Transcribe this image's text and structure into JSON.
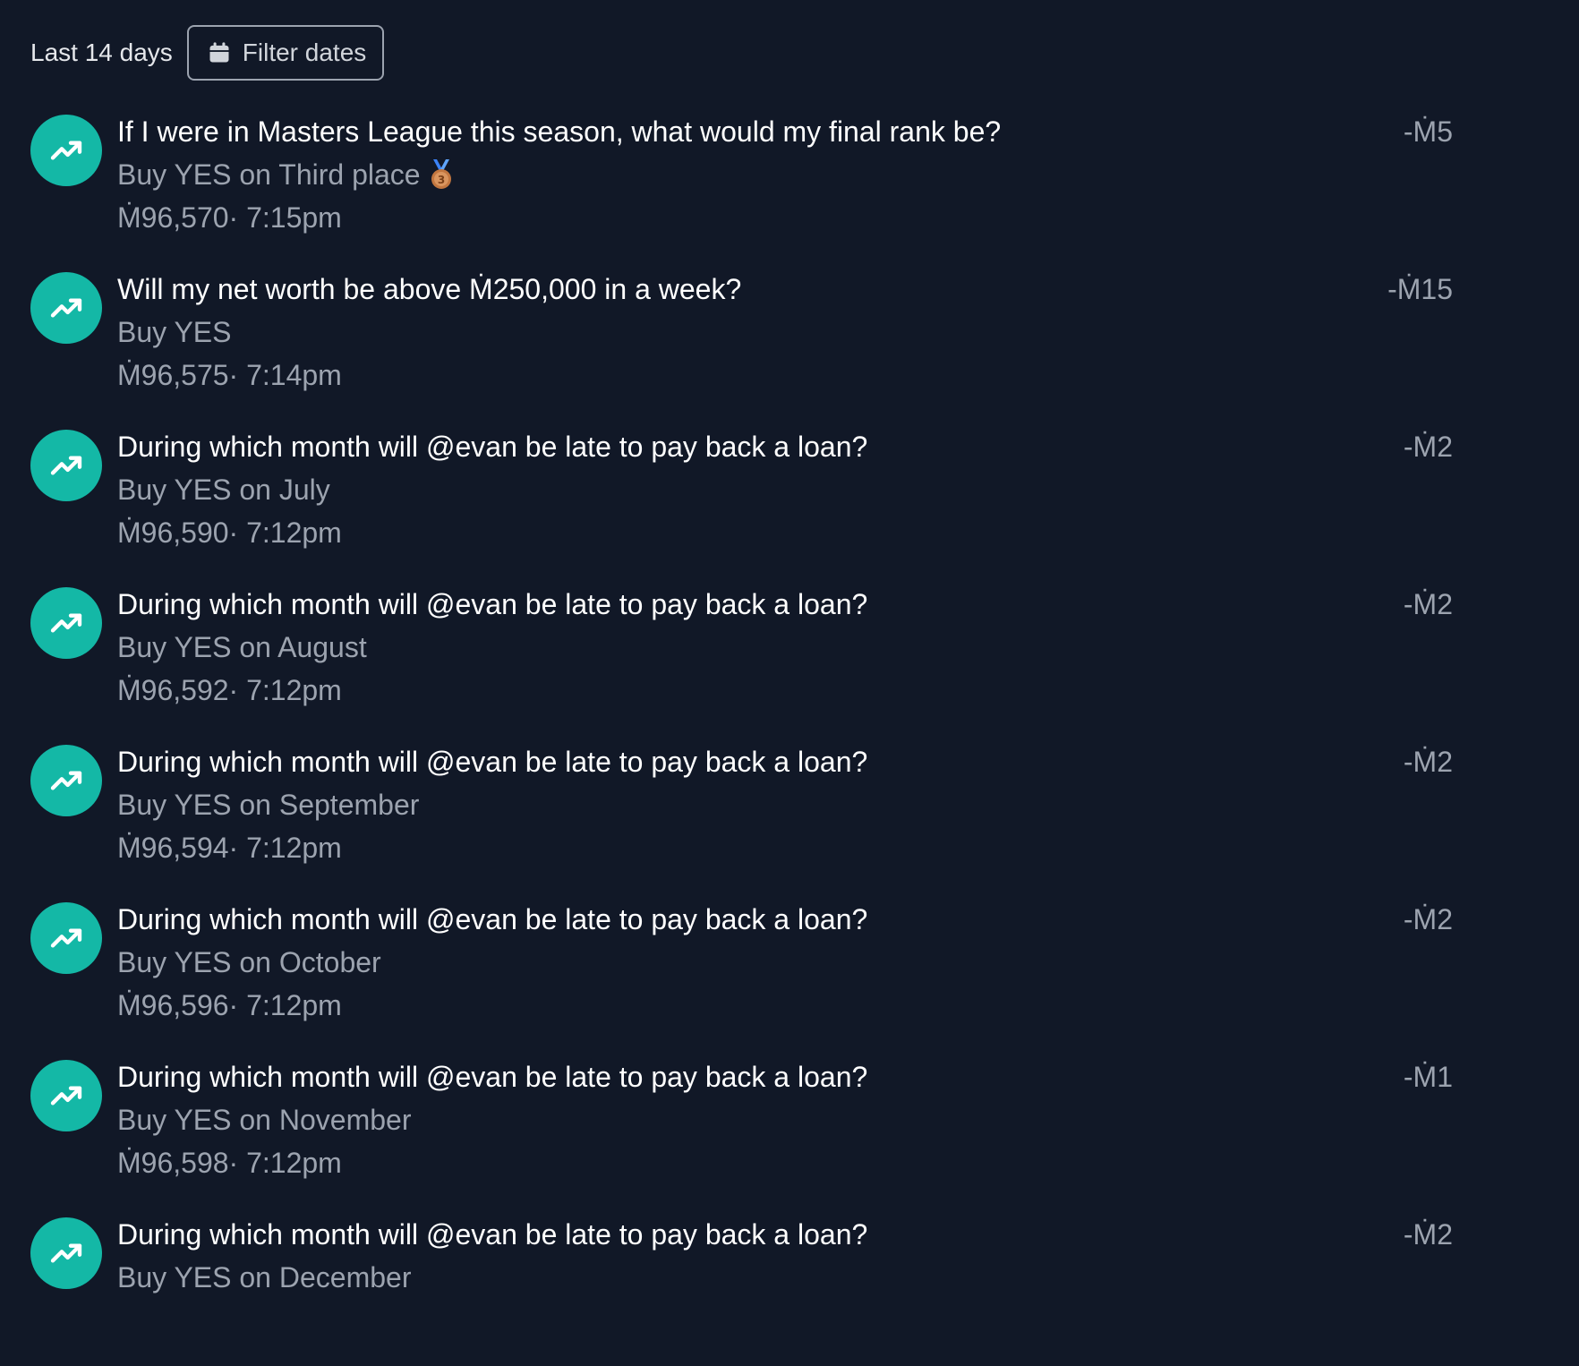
{
  "header": {
    "range_label": "Last 14 days",
    "filter_button_label": "Filter dates",
    "filter_icon": "calendar-icon"
  },
  "colors": {
    "background": "#111827",
    "accent": "#14b8a6",
    "text_primary": "#ffffff",
    "text_secondary": "#9ca3af"
  },
  "transactions": [
    {
      "icon": "trending-up-icon",
      "title": "If I were in Masters League this season, what would my final rank be?",
      "action": "Buy YES on Third place",
      "action_icon": "third-place-medal-icon",
      "meta": "Ṁ96,570· 7:15pm",
      "amount": "-Ṁ5"
    },
    {
      "icon": "trending-up-icon",
      "title": "Will my net worth be above Ṁ250,000 in a week?",
      "action": "Buy YES",
      "meta": "Ṁ96,575· 7:14pm",
      "amount": "-Ṁ15"
    },
    {
      "icon": "trending-up-icon",
      "title": "During which month will @evan be late to pay back a loan?",
      "action": "Buy YES on July",
      "meta": "Ṁ96,590· 7:12pm",
      "amount": "-Ṁ2"
    },
    {
      "icon": "trending-up-icon",
      "title": "During which month will @evan be late to pay back a loan?",
      "action": "Buy YES on August",
      "meta": "Ṁ96,592· 7:12pm",
      "amount": "-Ṁ2"
    },
    {
      "icon": "trending-up-icon",
      "title": "During which month will @evan be late to pay back a loan?",
      "action": "Buy YES on September",
      "meta": "Ṁ96,594· 7:12pm",
      "amount": "-Ṁ2"
    },
    {
      "icon": "trending-up-icon",
      "title": "During which month will @evan be late to pay back a loan?",
      "action": "Buy YES on October",
      "meta": "Ṁ96,596· 7:12pm",
      "amount": "-Ṁ2"
    },
    {
      "icon": "trending-up-icon",
      "title": "During which month will @evan be late to pay back a loan?",
      "action": "Buy YES on November",
      "meta": "Ṁ96,598· 7:12pm",
      "amount": "-Ṁ1"
    },
    {
      "icon": "trending-up-icon",
      "title": "During which month will @evan be late to pay back a loan?",
      "action": "Buy YES on December",
      "meta": "",
      "amount": "-Ṁ2"
    }
  ]
}
